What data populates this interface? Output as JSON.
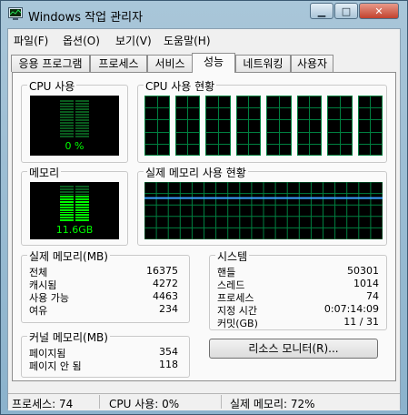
{
  "window": {
    "title": "Windows 작업 관리자",
    "min_icon": "minimize-icon",
    "max_icon": "maximize-icon",
    "close_icon": "close-icon",
    "min_glyph": "▁",
    "max_glyph": "□",
    "close_glyph": "✕"
  },
  "menu": [
    {
      "label": "파일(F)"
    },
    {
      "label": "옵션(O)"
    },
    {
      "label": "보기(V)"
    },
    {
      "label": "도움말(H)"
    }
  ],
  "tabs": [
    {
      "label": "응용 프로그램"
    },
    {
      "label": "프로세스"
    },
    {
      "label": "서비스"
    },
    {
      "label": "성능",
      "active": true
    },
    {
      "label": "네트워킹"
    },
    {
      "label": "사용자"
    }
  ],
  "cpu_usage": {
    "label": "CPU 사용",
    "value_text": "0 %",
    "percent": 0
  },
  "cpu_history": {
    "label": "CPU 사용 현황",
    "core_count": 8
  },
  "memory": {
    "label": "메모리",
    "value_text": "11.6GB",
    "percent": 72
  },
  "memory_history": {
    "label": "실제 메모리 사용 현황",
    "line_level_percent": 72
  },
  "physical_memory": {
    "label": "실제 메모리(MB)",
    "rows": [
      {
        "label": "전체",
        "value": "16375"
      },
      {
        "label": "캐시됨",
        "value": "4272"
      },
      {
        "label": "사용 가능",
        "value": "4463"
      },
      {
        "label": "여유",
        "value": "234"
      }
    ]
  },
  "system": {
    "label": "시스템",
    "rows": [
      {
        "label": "핸들",
        "value": "50301"
      },
      {
        "label": "스레드",
        "value": "1014"
      },
      {
        "label": "프로세스",
        "value": "74"
      },
      {
        "label": "지정 시간",
        "value": "0:07:14:09"
      },
      {
        "label": "커밋(GB)",
        "value": "11 / 31"
      }
    ]
  },
  "kernel_memory": {
    "label": "커널 메모리(MB)",
    "rows": [
      {
        "label": "페이지됨",
        "value": "354"
      },
      {
        "label": "페이지 안 됨",
        "value": "118"
      }
    ]
  },
  "resource_monitor_button": "리소스 모니터(R)...",
  "status": {
    "processes": "프로세스: 74",
    "cpu": "CPU 사용: 0%",
    "memory": "실제 메모리: 72%"
  },
  "colors": {
    "graph_green": "#00ff00",
    "grid_green": "#008040",
    "mem_line": "#3aa0ff"
  }
}
